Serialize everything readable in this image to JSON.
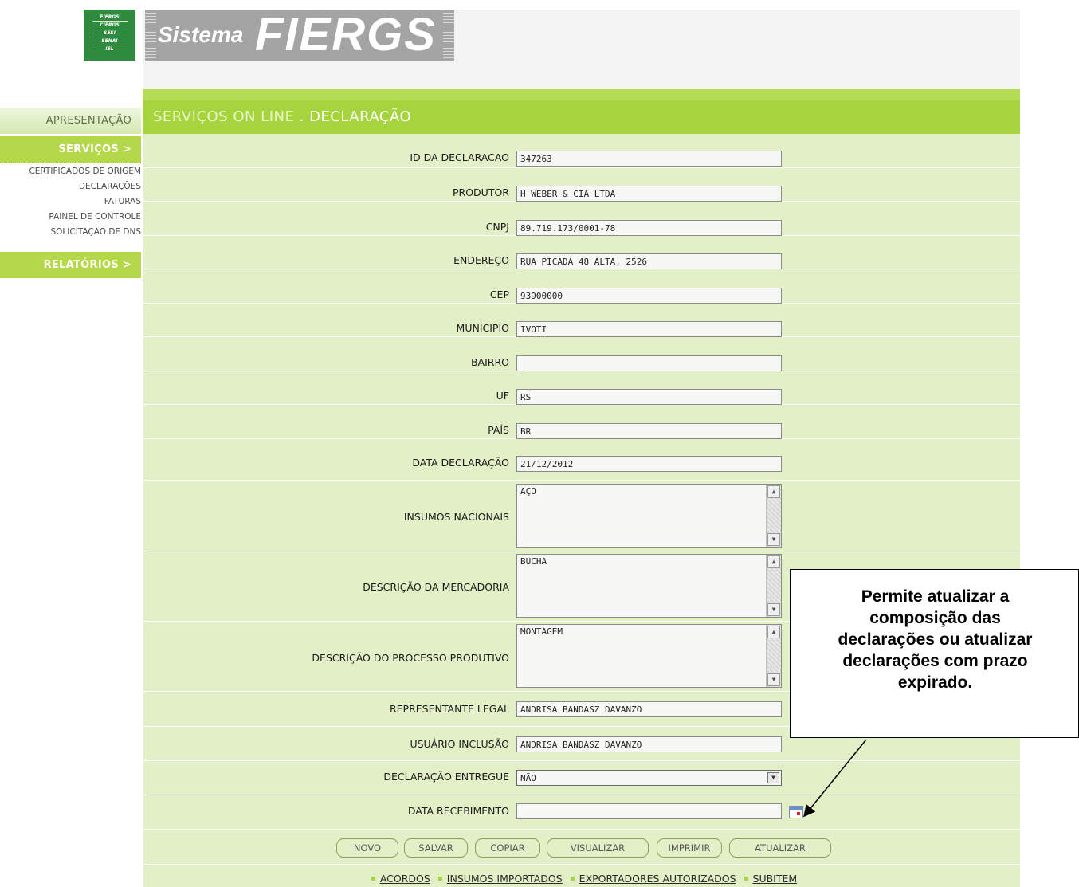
{
  "logo": {
    "small_lines": [
      "FIERGS",
      "CIERGS",
      "SESI",
      "SENAI",
      "IEL"
    ],
    "sistema": "Sistema",
    "fiergs": "FIERGS"
  },
  "nav": {
    "apresentacao": "APRESENTAÇÃO",
    "servicos": "SERVIÇOS >",
    "sub_items": [
      "CERTIFICADOS DE ORIGEM",
      "DECLARAÇÕES",
      "FATURAS",
      "PAINEL DE CONTROLE",
      "SOLICITAÇAO DE DNS"
    ],
    "relatorios": "RELATÓRIOS >"
  },
  "title": {
    "section": "SERVIÇOS ON LINE",
    "separator": ".",
    "page": "DECLARAÇÃO"
  },
  "form": {
    "id_declaracao": {
      "label": "ID DA DECLARACAO",
      "value": "347263"
    },
    "produtor": {
      "label": "PRODUTOR",
      "value": "H WEBER & CIA LTDA"
    },
    "cnpj": {
      "label": "CNPJ",
      "value": "89.719.173/0001-78"
    },
    "endereco": {
      "label": "ENDEREÇO",
      "value": "RUA PICADA 48 ALTA, 2526"
    },
    "cep": {
      "label": "CEP",
      "value": "93900000"
    },
    "municipio": {
      "label": "MUNICIPIO",
      "value": "IVOTI"
    },
    "bairro": {
      "label": "BAIRRO",
      "value": ""
    },
    "uf": {
      "label": "UF",
      "value": "RS"
    },
    "pais": {
      "label": "PAÍS",
      "value": "BR"
    },
    "data_declaracao": {
      "label": "DATA DECLARAÇÃO",
      "value": "21/12/2012"
    },
    "insumos_nacionais": {
      "label": "INSUMOS NACIONAIS",
      "value": "AÇO"
    },
    "descricao_mercadoria": {
      "label": "DESCRIÇÃO DA MERCADORIA",
      "value": "BUCHA"
    },
    "descricao_processo": {
      "label": "DESCRIÇÃO DO PROCESSO PRODUTIVO",
      "value": "MONTAGEM"
    },
    "representante_legal": {
      "label": "REPRESENTANTE LEGAL",
      "value": "ANDRISA BANDASZ DAVANZO"
    },
    "usuario_inclusao": {
      "label": "USUÁRIO INCLUSÃO",
      "value": "ANDRISA BANDASZ DAVANZO"
    },
    "declaracao_entregue": {
      "label": "DECLARAÇÃO ENTREGUE",
      "value": "NÃO"
    },
    "data_recebimento": {
      "label": "DATA RECEBIMENTO",
      "value": ""
    }
  },
  "buttons": {
    "novo": "NOVO",
    "salvar": "SALVAR",
    "copiar": "COPIAR",
    "visualizar": "VISUALIZAR",
    "imprimir": "IMPRIMIR",
    "atualizar": "ATUALIZAR"
  },
  "footer_links": [
    "ACORDOS",
    "INSUMOS IMPORTADOS",
    "EXPORTADORES AUTORIZADOS",
    "SUBITEM"
  ],
  "callout": {
    "lines": [
      "Permite atualizar a",
      "composição das",
      "declarações ou atualizar",
      "declarações com prazo",
      "expirado."
    ]
  },
  "colors": {
    "accent_green": "#a6d43d",
    "form_bg": "#e3efc6",
    "logo_green": "#2e8b3e",
    "logo_gray": "#a4a4a4"
  }
}
